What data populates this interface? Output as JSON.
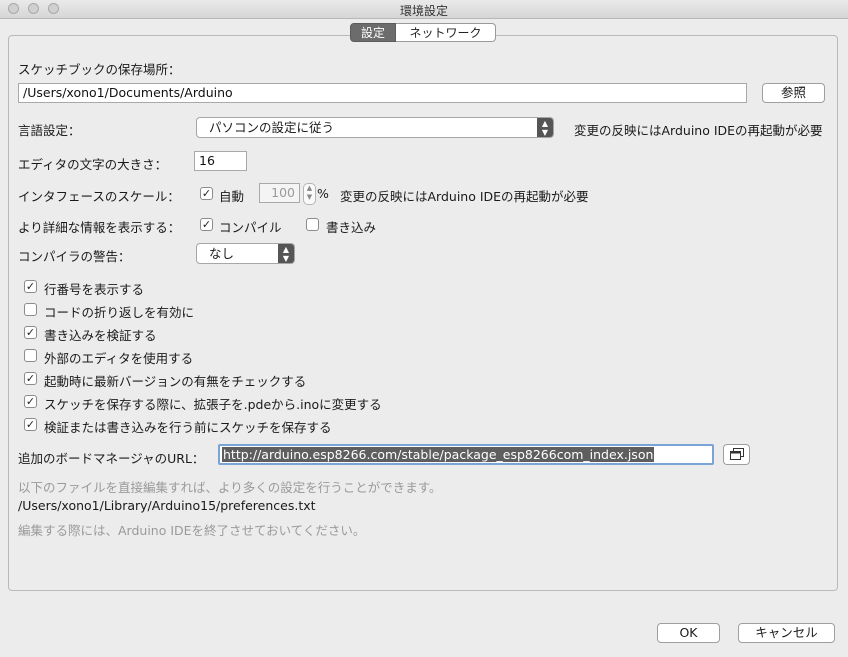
{
  "window": {
    "title": "環境設定"
  },
  "tabs": [
    {
      "label": "設定"
    },
    {
      "label": "ネットワーク"
    }
  ],
  "sketchbook": {
    "label": "スケッチブックの保存場所：",
    "path": "/Users/xono1/Documents/Arduino",
    "browse_label": "参照"
  },
  "language": {
    "label": "言語設定：",
    "selected": "パソコンの設定に従う",
    "note": "変更の反映にはArduino IDEの再起動が必要"
  },
  "font_size": {
    "label": "エディタの文字の大きさ：",
    "value": "16"
  },
  "scale": {
    "label": "インタフェースのスケール：",
    "auto_label": "自動",
    "auto_checked": true,
    "value": "100",
    "unit": "%",
    "note": "変更の反映にはArduino IDEの再起動が必要"
  },
  "verbose": {
    "label": "より詳細な情報を表示する：",
    "compile_label": "コンパイル",
    "compile_checked": true,
    "upload_label": "書き込み",
    "upload_checked": false
  },
  "warnings": {
    "label": "コンパイラの警告：",
    "selected": "なし"
  },
  "options": [
    {
      "label": "行番号を表示する",
      "checked": true
    },
    {
      "label": "コードの折り返しを有効に",
      "checked": false
    },
    {
      "label": "書き込みを検証する",
      "checked": true
    },
    {
      "label": "外部のエディタを使用する",
      "checked": false
    },
    {
      "label": "起動時に最新バージョンの有無をチェックする",
      "checked": true
    },
    {
      "label": "スケッチを保存する際に、拡張子を.pdeから.inoに変更する",
      "checked": true
    },
    {
      "label": "検証または書き込みを行う前にスケッチを保存する",
      "checked": true
    }
  ],
  "board_url": {
    "label": "追加のボードマネージャのURL：",
    "value": "http://arduino.esp8266.com/stable/package_esp8266com_index.json"
  },
  "footer": {
    "hint": "以下のファイルを直接編集すれば、より多くの設定を行うことができます。",
    "prefs_path": "/Users/xono1/Library/Arduino15/preferences.txt",
    "hint2": "編集する際には、Arduino IDEを終了させておいてください。"
  },
  "buttons": {
    "ok": "OK",
    "cancel": "キャンセル"
  }
}
